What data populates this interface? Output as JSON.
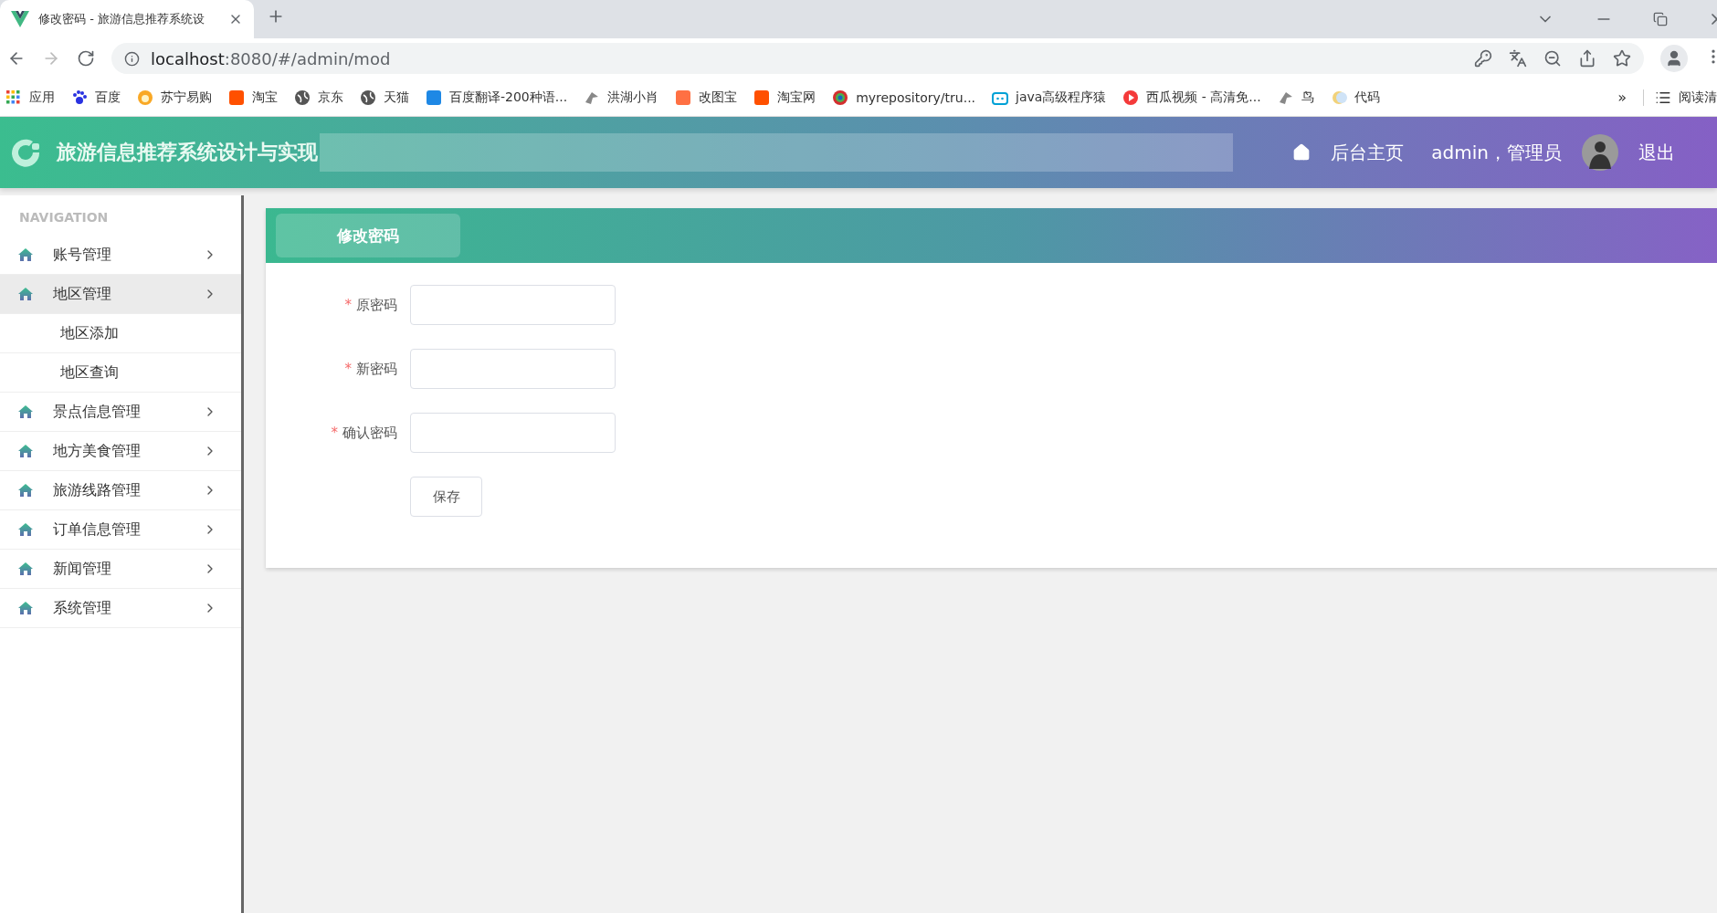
{
  "browser": {
    "tab": {
      "title": "修改密码 - 旅游信息推荐系统设",
      "selected": true
    },
    "address": {
      "host": "localhost",
      "path": ":8080/#/admin/mod"
    },
    "bookmarks": [
      {
        "label": "应用",
        "kind": "grid"
      },
      {
        "label": "百度",
        "kind": "paw"
      },
      {
        "label": "苏宁易购",
        "kind": "sun"
      },
      {
        "label": "淘宝",
        "kind": "tag"
      },
      {
        "label": "京东",
        "kind": "globe"
      },
      {
        "label": "天猫",
        "kind": "globe"
      },
      {
        "label": "百度翻译-200种语...",
        "kind": "square"
      },
      {
        "label": "洪湖小肖",
        "kind": "bird"
      },
      {
        "label": "改图宝",
        "kind": "tile"
      },
      {
        "label": "淘宝网",
        "kind": "tag"
      },
      {
        "label": "myrepository/tru...",
        "kind": "ring"
      },
      {
        "label": "java高级程序猿",
        "kind": "tv"
      },
      {
        "label": "西瓜视频 - 高清免...",
        "kind": "play"
      },
      {
        "label": "鸟",
        "kind": "bird"
      },
      {
        "label": "代码",
        "kind": "moon"
      }
    ],
    "overflow": "»",
    "reading_list": "阅读清"
  },
  "header": {
    "title": "旅游信息推荐系统设计与实现",
    "home": "后台主页",
    "user": "admin，管理员",
    "logout": "退出"
  },
  "sidebar": {
    "heading": "NAVIGATION",
    "items": [
      {
        "label": "账号管理",
        "selected": false
      },
      {
        "label": "地区管理",
        "selected": true,
        "children": [
          {
            "label": "地区添加"
          },
          {
            "label": "地区查询"
          }
        ]
      },
      {
        "label": "景点信息管理",
        "selected": false
      },
      {
        "label": "地方美食管理",
        "selected": false
      },
      {
        "label": "旅游线路管理",
        "selected": false
      },
      {
        "label": "订单信息管理",
        "selected": false
      },
      {
        "label": "新闻管理",
        "selected": false
      },
      {
        "label": "系统管理",
        "selected": false
      }
    ]
  },
  "content": {
    "tabs": [
      {
        "label": "修改密码",
        "selected": true
      }
    ],
    "form": {
      "fields": [
        {
          "label": "原密码",
          "required_mark": "*"
        },
        {
          "label": "新密码",
          "required_mark": "*"
        },
        {
          "label": "确认密码",
          "required_mark": "*"
        }
      ],
      "submit": "保存"
    }
  }
}
